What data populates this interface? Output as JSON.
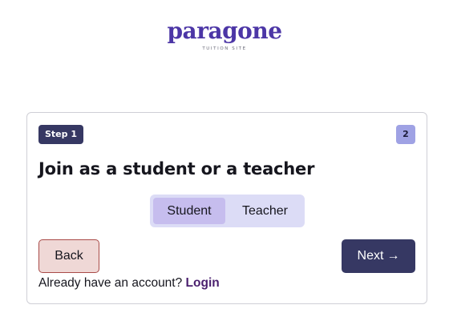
{
  "logo": {
    "wordmark": "paragone",
    "tagline": "TUITION SITE"
  },
  "wizard": {
    "step_label": "Step 1",
    "total_steps": "2",
    "heading": "Join as a student or a teacher",
    "role_options": [
      {
        "label": "Student",
        "selected": true
      },
      {
        "label": "Teacher",
        "selected": false
      }
    ],
    "back_label": "Back",
    "next_label": "Next",
    "next_icon": "arrow-right-icon",
    "login_prompt": "Already have an account?",
    "login_link": "Login"
  },
  "colors": {
    "brand_purple": "#4c36a6",
    "primary_navy": "#363863",
    "step_count_bg": "#9fa2e4",
    "segment_bg": "#dcdcf6",
    "segment_selected": "#c6bdee",
    "back_bg": "#efd8d6",
    "back_border": "#a94b48",
    "link": "#4a1f6e"
  }
}
